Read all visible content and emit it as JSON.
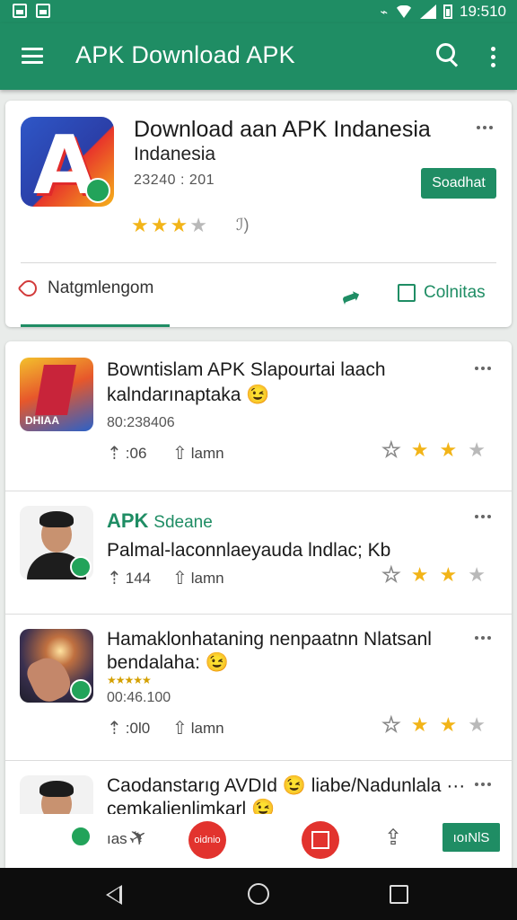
{
  "status_bar": {
    "time": "19:510"
  },
  "app_bar": {
    "title": "APK Download APK"
  },
  "featured": {
    "title": "Download aan APK Indanesia",
    "subtitle": "Indanesia",
    "date": "23240 : 201",
    "button_label": "Soadhat",
    "rating": 3,
    "rating_extra": "ℐ)",
    "tab_left_label": "Natgmlengom",
    "tab_right_label": "Colnitas"
  },
  "list": [
    {
      "title": "Bowntislam APK Slapourtai laach",
      "title2": "kalndarınaptaka 😉",
      "date": "80:238406",
      "stat1": ":06",
      "stat2": "lamn",
      "rating_filled": 2
    },
    {
      "title_apk": "APK",
      "title_apk_sub": "Sdeane",
      "title2": "Palmal-laconnlaeyauda lndlac; Kb",
      "stat1": "144",
      "stat2": "lamn",
      "rating_filled": 2
    },
    {
      "title": "Hamaklonhataning nenpaatnn Nlatsanl",
      "title2": "bendalaha: 😉",
      "mini_stars": "★★★★★",
      "date": "00:46.100",
      "stat1": ":0l0",
      "stat2": "lamn",
      "rating_filled": 2
    },
    {
      "title": "Caodanstarıg AVDId 😉 liabe/Nadunlala ···",
      "title2": "cemkalienlimkarl 😉",
      "stat_partial": "ıas"
    }
  ],
  "bottom_actions": {
    "red_left_label": "oidnio",
    "green_label": "ıoıNlS"
  },
  "icons": {
    "menu": "menu-icon",
    "search": "search-icon",
    "more": "more-vert-icon",
    "tag": "tag-icon",
    "share": "share-icon",
    "checkbox": "checkbox-icon",
    "download": "download-icon",
    "upload": "upload-icon",
    "pin": "pin-icon",
    "bookmark": "bookmark-icon",
    "back": "nav-back-icon",
    "home": "nav-home-icon",
    "recents": "nav-recents-icon"
  },
  "colors": {
    "primary": "#1f8d64",
    "star": "#f2b418",
    "accent_red": "#e2332e"
  }
}
